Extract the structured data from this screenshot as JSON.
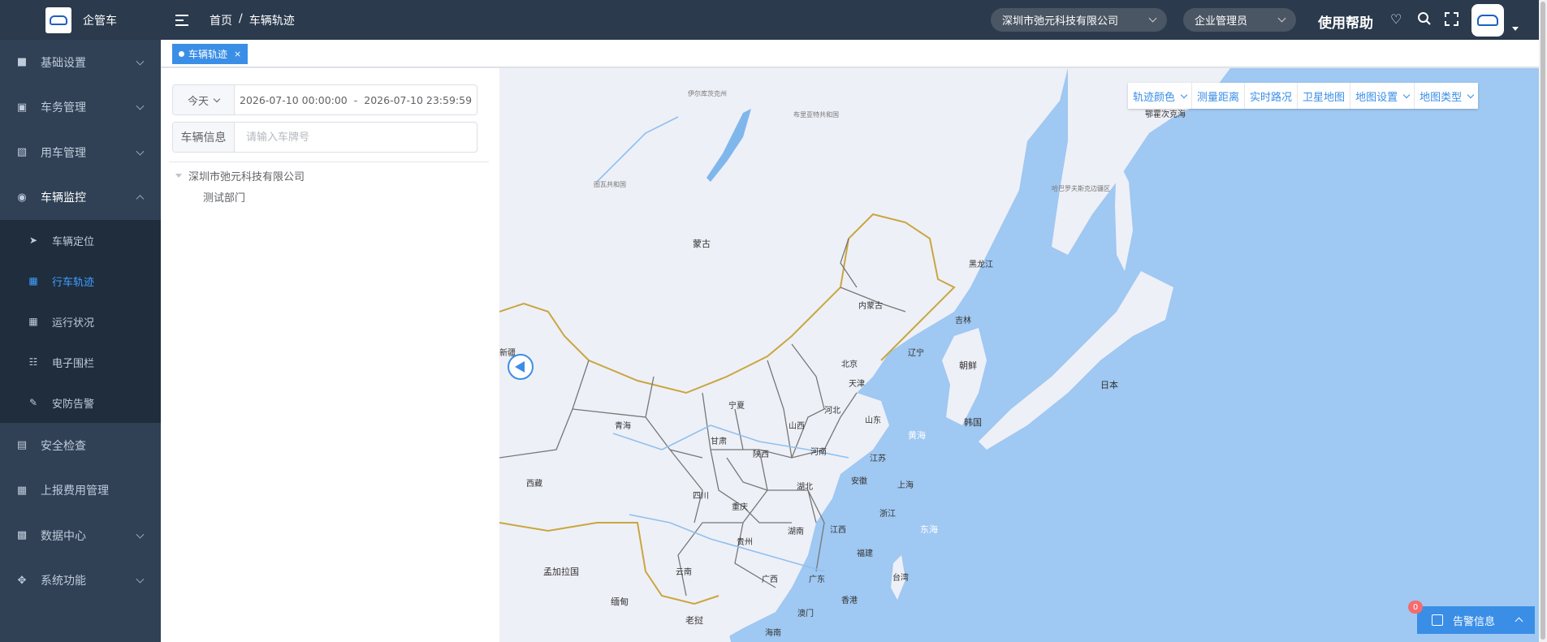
{
  "app": {
    "name": "企管车"
  },
  "sidebar": {
    "items": [
      {
        "label": "基础设置",
        "icon": "user-setting-icon",
        "expandable": true
      },
      {
        "label": "车务管理",
        "icon": "monitor-icon",
        "expandable": true
      },
      {
        "label": "用车管理",
        "icon": "car-use-icon",
        "expandable": true
      },
      {
        "label": "车辆监控",
        "icon": "globe-icon",
        "expandable": true,
        "open": true
      },
      {
        "label": "安全检查",
        "icon": "inspection-icon",
        "expandable": false
      },
      {
        "label": "上报费用管理",
        "icon": "grid-icon",
        "expandable": false
      },
      {
        "label": "数据中心",
        "icon": "database-icon",
        "expandable": true
      },
      {
        "label": "系统功能",
        "icon": "settings-icon",
        "expandable": true
      }
    ],
    "sub_items": [
      {
        "label": "车辆定位",
        "icon": "locate-icon"
      },
      {
        "label": "行车轨迹",
        "icon": "track-icon",
        "active": true
      },
      {
        "label": "运行状况",
        "icon": "table-icon"
      },
      {
        "label": "电子围栏",
        "icon": "fence-icon"
      },
      {
        "label": "安防告警",
        "icon": "alarm-edit-icon"
      }
    ]
  },
  "header": {
    "breadcrumb": [
      "首页",
      "车辆轨迹"
    ],
    "company_select": "深圳市弛元科技有限公司",
    "role_select": "企业管理员",
    "help": "使用帮助"
  },
  "tabs": [
    {
      "label": "车辆轨迹",
      "active": true
    }
  ],
  "panel": {
    "date_preset": "今天",
    "date_start": "2026-07-10 00:00:00",
    "date_sep": "-",
    "date_end": "2026-07-10 23:59:59",
    "vehicle_label": "车辆信息",
    "vehicle_placeholder": "请输入车牌号",
    "tree": {
      "root": "深圳市弛元科技有限公司",
      "children": [
        "测试部门"
      ]
    }
  },
  "map": {
    "toolbar": [
      {
        "label": "轨迹颜色",
        "dropdown": true
      },
      {
        "label": "测量距离",
        "dropdown": false
      },
      {
        "label": "实时路况",
        "dropdown": false
      },
      {
        "label": "卫星地图",
        "dropdown": false
      },
      {
        "label": "地图设置",
        "dropdown": true
      },
      {
        "label": "地图类型",
        "dropdown": true
      }
    ],
    "labels": {
      "mongolia": "蒙古",
      "xinjiang": "新疆",
      "qinghai": "青海",
      "xizang": "西藏",
      "gansu": "甘肃",
      "ningxia": "宁夏",
      "neimenggu": "内蒙古",
      "heilongjiang": "黑龙江",
      "jilin": "吉林",
      "liaoning": "辽宁",
      "beijing": "北京",
      "tianjin": "天津",
      "hebei": "河北",
      "shanxi": "山西",
      "shandong": "山东",
      "henan": "河南",
      "shaanxi": "陕西",
      "jiangsu": "江苏",
      "shanghai": "上海",
      "anhui": "安徽",
      "hubei": "湖北",
      "sichuan": "四川",
      "chongqing": "重庆",
      "zhejiang": "浙江",
      "hunan": "湖南",
      "jiangxi": "江西",
      "guizhou": "贵州",
      "yunnan": "云南",
      "guangxi": "广西",
      "guangdong": "广东",
      "fujian": "福建",
      "taiwan": "台湾",
      "hongkong": "香港",
      "macau": "澳门",
      "hainan": "海南",
      "north_korea": "朝鲜",
      "south_korea": "韩国",
      "japan": "日本",
      "bangladesh": "孟加拉国",
      "myanmar": "缅甸",
      "laos": "老挝",
      "yellow_sea": "黄海",
      "east_sea": "东海",
      "okhotsk": "鄂霍次克海",
      "irkutsk": "伊尔库茨克州",
      "buryatia": "布里亚特共和国",
      "tuva": "图瓦共和国",
      "khabarovsk": "哈巴罗夫斯克边疆区"
    }
  },
  "alarm": {
    "label": "告警信息",
    "count": "0"
  },
  "colors": {
    "sidebar_bg": "#304156",
    "header_bg": "#2b3a4d",
    "accent": "#3a8ee6",
    "map_sea": "#9fc8f2",
    "map_land": "#eef0f7"
  }
}
